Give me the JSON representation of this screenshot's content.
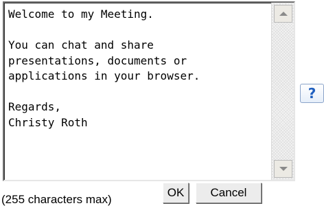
{
  "message": {
    "text": "Welcome to my Meeting.\n\nYou can chat and share\npresentations, documents or\napplications in your browser.\n\nRegards,\nChristy Roth"
  },
  "help": {
    "label": "?",
    "icon": "help-icon"
  },
  "footer": {
    "char_limit": "(255 characters max)",
    "ok_label": "OK",
    "cancel_label": "Cancel"
  },
  "colors": {
    "help_glyph": "#1f5fbf",
    "button_face": "#ececec",
    "scrollbar_track": "#f3f3f3"
  }
}
